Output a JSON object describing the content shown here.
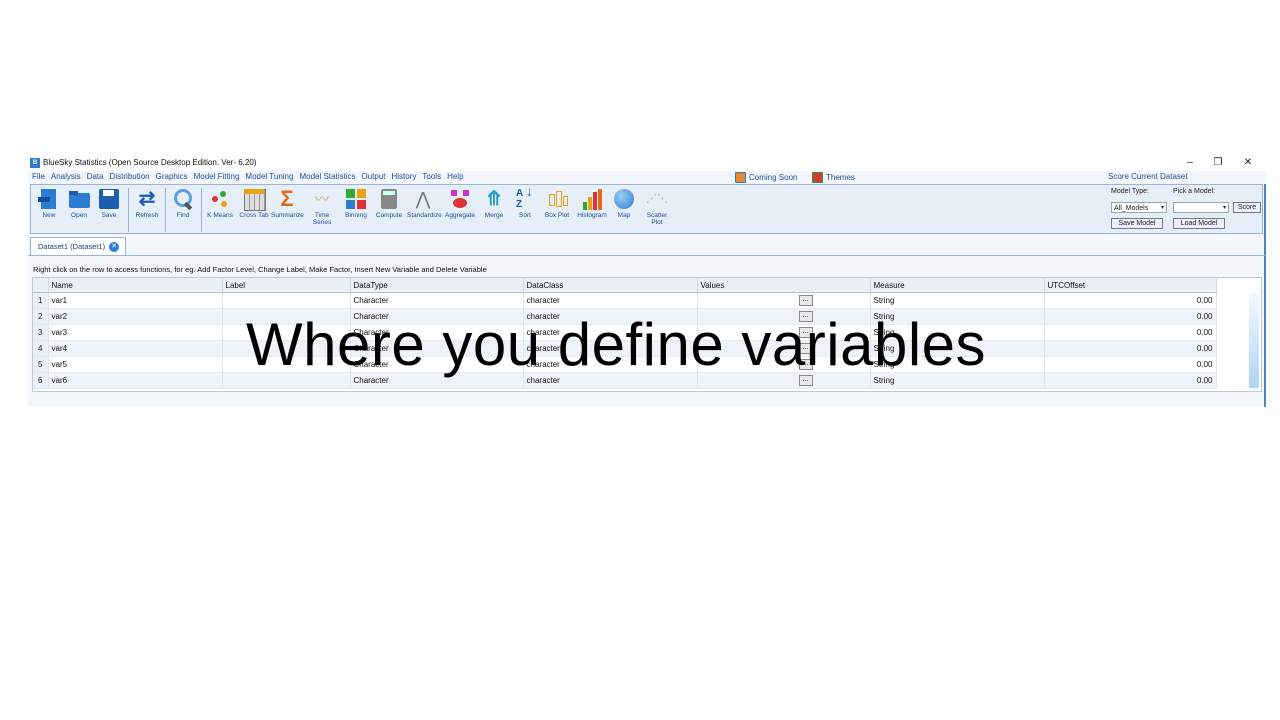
{
  "window": {
    "title": "BlueSky Statistics (Open Source Desktop Edition. Ver- 6.20)",
    "icon_text": "B",
    "controls": [
      "–",
      "❐",
      "✕"
    ]
  },
  "menu": {
    "items": [
      "File",
      "Analysis",
      "Data",
      "Distribution",
      "Graphics",
      "Model Fitting",
      "Model Tuning",
      "Model Statistics",
      "Output",
      "History",
      "Tools",
      "Help"
    ],
    "coming_soon": "Coming Soon",
    "themes": "Themes",
    "score_current": "Score Current Dataset"
  },
  "toolbar": {
    "new": "New",
    "open": "Open",
    "save": "Save",
    "refresh": "Refresh",
    "find": "Find",
    "kmeans": "K Means",
    "crosstab": "Cross Tab",
    "summarize": "Summarize",
    "timeseries_1": "Time",
    "timeseries_2": "Series",
    "binning": "Binning",
    "compute": "Compute",
    "standardize": "Standardize",
    "aggregate": "Aggregate",
    "merge": "Merge",
    "sort": "Sort",
    "boxplot": "Box Plot",
    "histogram": "Histogram",
    "map": "Map",
    "scatter_1": "Scatter",
    "scatter_2": "Plot"
  },
  "model_panel": {
    "model_type_label": "Model Type:",
    "pick_model_label": "Pick a Model:",
    "model_type_value": "All_Models",
    "pick_model_value": "",
    "score": "Score",
    "save_model": "Save Model",
    "load_model": "Load Model"
  },
  "tabs": {
    "dataset1": "Dataset1 (Dataset1)"
  },
  "hint": "Right click on the row to access functions, for eg. Add Factor Level, Change Label, Make Factor, Insert New Variable and Delete Variable",
  "grid": {
    "headers": [
      "Name",
      "Label",
      "DataType",
      "DataClass",
      "Values",
      "Measure",
      "UTCOffset"
    ],
    "rows": [
      {
        "num": "1",
        "name": "var1",
        "label": "",
        "datatype": "Character",
        "dataclass": "character",
        "values": "...",
        "measure": "String",
        "utc": "0.00"
      },
      {
        "num": "2",
        "name": "var2",
        "label": "",
        "datatype": "Character",
        "dataclass": "character",
        "values": "...",
        "measure": "String",
        "utc": "0.00"
      },
      {
        "num": "3",
        "name": "var3",
        "label": "",
        "datatype": "Character",
        "dataclass": "character",
        "values": "...",
        "measure": "String",
        "utc": "0.00"
      },
      {
        "num": "4",
        "name": "var4",
        "label": "",
        "datatype": "Character",
        "dataclass": "character",
        "values": "...",
        "measure": "String",
        "utc": "0.00"
      },
      {
        "num": "5",
        "name": "var5",
        "label": "",
        "datatype": "Character",
        "dataclass": "character",
        "values": "...",
        "measure": "String",
        "utc": "0.00"
      },
      {
        "num": "6",
        "name": "var6",
        "label": "",
        "datatype": "Character",
        "dataclass": "character",
        "values": "...",
        "measure": "String",
        "utc": "0.00"
      }
    ]
  },
  "overlay": {
    "caption": "Where you define variables"
  },
  "colors": {
    "accent": "#2b7cd3",
    "menu_text": "#1e4fa0",
    "toolbar_bg": "#e6eef7"
  }
}
